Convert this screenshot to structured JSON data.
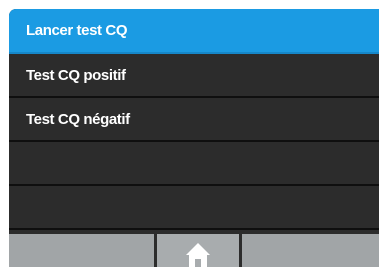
{
  "menu": {
    "items": [
      {
        "label": "Lancer test CQ"
      },
      {
        "label": "Test CQ positif"
      },
      {
        "label": "Test CQ négatif"
      },
      {
        "label": ""
      },
      {
        "label": ""
      }
    ],
    "selected_index": 0
  },
  "bottom_bar": {
    "home_icon": "home-icon"
  },
  "colors": {
    "accent": "#1b9be3",
    "menu_background": "#2c2c2c",
    "bar_background": "#a1a5a7",
    "text": "#ffffff"
  }
}
